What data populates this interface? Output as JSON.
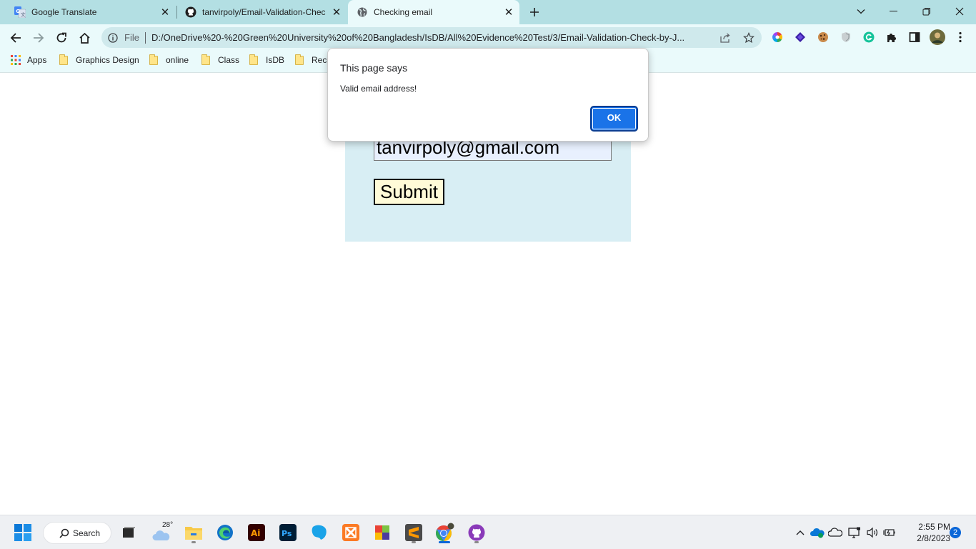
{
  "browser": {
    "tabs": [
      {
        "title": "Google Translate",
        "icon": "google-translate-icon"
      },
      {
        "title": "tanvirpoly/Email-Validation-Chec",
        "icon": "github-icon"
      },
      {
        "title": "Checking email",
        "icon": "globe-icon"
      }
    ],
    "address": {
      "scheme_label": "File",
      "url": "D:/OneDrive%20-%20Green%20University%20of%20Bangladesh/IsDB/All%20Evidence%20Test/3/Email-Validation-Check-by-J..."
    },
    "bookmarks": {
      "apps_label": "Apps",
      "items": [
        "Graphics Design",
        "online",
        "Class",
        "IsDB",
        "Rece"
      ]
    }
  },
  "page": {
    "email_value": "tanvirpoly@gmail.com",
    "submit_label": "Submit"
  },
  "alert": {
    "title": "This page says",
    "message": "Valid email address!",
    "ok_label": "OK"
  },
  "taskbar": {
    "search_label": "Search",
    "weather_temp": "28°",
    "time": "2:55 PM",
    "date": "2/8/2023",
    "notification_count": "2"
  },
  "colors": {
    "tabstrip_bg": "#b3dfe3",
    "toolbar_bg": "#eafafb",
    "form_panel_bg": "#d8eef4",
    "submit_bg": "#fffbd8",
    "ok_button": "#1a73e8"
  }
}
